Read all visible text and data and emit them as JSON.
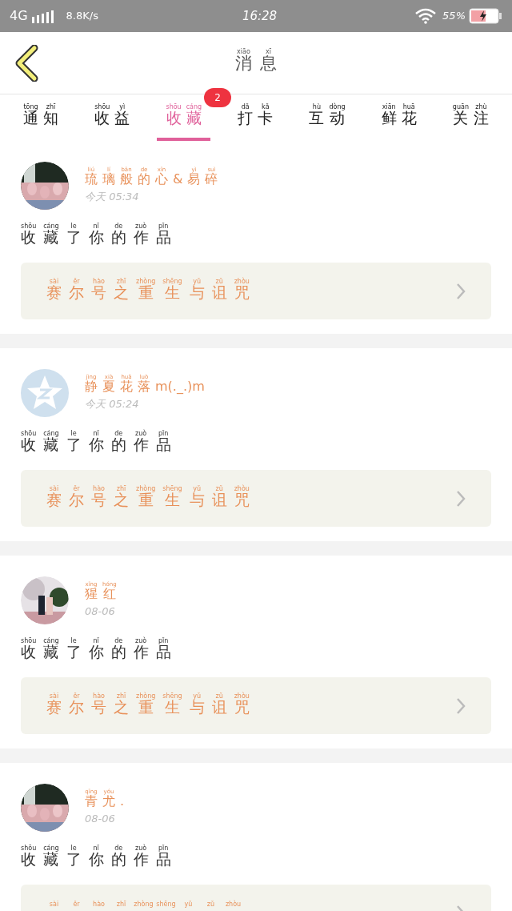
{
  "status_bar": {
    "network": "4G",
    "speed": "8.8K/s",
    "time": "16:28",
    "battery": "55%"
  },
  "header": {
    "title": [
      {
        "pinyin": "xiāo",
        "char": "消"
      },
      {
        "pinyin": "xī",
        "char": "息"
      }
    ]
  },
  "tabs": [
    {
      "label": [
        {
          "pinyin": "tōng",
          "char": "通"
        },
        {
          "pinyin": "zhī",
          "char": "知"
        }
      ],
      "selected": false
    },
    {
      "label": [
        {
          "pinyin": "shōu",
          "char": "收"
        },
        {
          "pinyin": "yì",
          "char": "益"
        }
      ],
      "selected": false
    },
    {
      "label": [
        {
          "pinyin": "shōu",
          "char": "收"
        },
        {
          "pinyin": "cáng",
          "char": "藏"
        }
      ],
      "selected": true,
      "badge": "2"
    },
    {
      "label": [
        {
          "pinyin": "dǎ",
          "char": "打"
        },
        {
          "pinyin": "kǎ",
          "char": "卡"
        }
      ],
      "selected": false
    },
    {
      "label": [
        {
          "pinyin": "hù",
          "char": "互"
        },
        {
          "pinyin": "dòng",
          "char": "动"
        }
      ],
      "selected": false
    },
    {
      "label": [
        {
          "pinyin": "xiān",
          "char": "鲜"
        },
        {
          "pinyin": "huā",
          "char": "花"
        }
      ],
      "selected": false
    },
    {
      "label": [
        {
          "pinyin": "guān",
          "char": "关"
        },
        {
          "pinyin": "zhù",
          "char": "注"
        }
      ],
      "selected": false
    }
  ],
  "items": [
    {
      "avatar": {
        "kind": "picture"
      },
      "name": [
        {
          "pinyin": "liú",
          "char": "琉"
        },
        {
          "pinyin": "lí",
          "char": "璃"
        },
        {
          "pinyin": "bān",
          "char": "般"
        },
        {
          "pinyin": "de",
          "char": "的"
        },
        {
          "pinyin": "xīn",
          "char": "心"
        },
        {
          "char": "&"
        },
        {
          "pinyin": "yì",
          "char": "易"
        },
        {
          "pinyin": "suì",
          "char": "碎"
        }
      ],
      "time": "今天 05:34",
      "action": [
        {
          "pinyin": "shōu",
          "char": "收"
        },
        {
          "pinyin": "cáng",
          "char": "藏"
        },
        {
          "pinyin": "le",
          "char": "了"
        },
        {
          "pinyin": "nǐ",
          "char": "你"
        },
        {
          "pinyin": "de",
          "char": "的"
        },
        {
          "pinyin": "zuò",
          "char": "作"
        },
        {
          "pinyin": "pǐn",
          "char": "品"
        }
      ],
      "work_title": [
        {
          "pinyin": "sài",
          "char": "赛"
        },
        {
          "pinyin": "ěr",
          "char": "尔"
        },
        {
          "pinyin": "hào",
          "char": "号"
        },
        {
          "pinyin": "zhī",
          "char": "之"
        },
        {
          "pinyin": "zhòng",
          "char": "重"
        },
        {
          "pinyin": "shēng",
          "char": "生"
        },
        {
          "pinyin": "yǔ",
          "char": "与"
        },
        {
          "pinyin": "zǔ",
          "char": "诅"
        },
        {
          "pinyin": "zhòu",
          "char": "咒"
        }
      ]
    },
    {
      "avatar": {
        "kind": "default"
      },
      "name": [
        {
          "pinyin": "jìng",
          "char": "静"
        },
        {
          "pinyin": "xià",
          "char": "夏"
        },
        {
          "pinyin": "huā",
          "char": "花"
        },
        {
          "pinyin": "luò",
          "char": "落"
        },
        {
          "char": "m(._.)m"
        }
      ],
      "time": "今天 05:24",
      "action": [
        {
          "pinyin": "shōu",
          "char": "收"
        },
        {
          "pinyin": "cáng",
          "char": "藏"
        },
        {
          "pinyin": "le",
          "char": "了"
        },
        {
          "pinyin": "nǐ",
          "char": "你"
        },
        {
          "pinyin": "de",
          "char": "的"
        },
        {
          "pinyin": "zuò",
          "char": "作"
        },
        {
          "pinyin": "pǐn",
          "char": "品"
        }
      ],
      "work_title": [
        {
          "pinyin": "sài",
          "char": "赛"
        },
        {
          "pinyin": "ěr",
          "char": "尔"
        },
        {
          "pinyin": "hào",
          "char": "号"
        },
        {
          "pinyin": "zhī",
          "char": "之"
        },
        {
          "pinyin": "zhòng",
          "char": "重"
        },
        {
          "pinyin": "shēng",
          "char": "生"
        },
        {
          "pinyin": "yǔ",
          "char": "与"
        },
        {
          "pinyin": "zǔ",
          "char": "诅"
        },
        {
          "pinyin": "zhòu",
          "char": "咒"
        }
      ]
    },
    {
      "avatar": {
        "kind": "picture"
      },
      "name": [
        {
          "pinyin": "xīng",
          "char": "猩"
        },
        {
          "pinyin": "hóng",
          "char": "红"
        }
      ],
      "time": "08-06",
      "action": [
        {
          "pinyin": "shōu",
          "char": "收"
        },
        {
          "pinyin": "cáng",
          "char": "藏"
        },
        {
          "pinyin": "le",
          "char": "了"
        },
        {
          "pinyin": "nǐ",
          "char": "你"
        },
        {
          "pinyin": "de",
          "char": "的"
        },
        {
          "pinyin": "zuò",
          "char": "作"
        },
        {
          "pinyin": "pǐn",
          "char": "品"
        }
      ],
      "work_title": [
        {
          "pinyin": "sài",
          "char": "赛"
        },
        {
          "pinyin": "ěr",
          "char": "尔"
        },
        {
          "pinyin": "hào",
          "char": "号"
        },
        {
          "pinyin": "zhī",
          "char": "之"
        },
        {
          "pinyin": "zhòng",
          "char": "重"
        },
        {
          "pinyin": "shēng",
          "char": "生"
        },
        {
          "pinyin": "yǔ",
          "char": "与"
        },
        {
          "pinyin": "zǔ",
          "char": "诅"
        },
        {
          "pinyin": "zhòu",
          "char": "咒"
        }
      ]
    },
    {
      "avatar": {
        "kind": "picture"
      },
      "name": [
        {
          "pinyin": "qīng",
          "char": "青"
        },
        {
          "pinyin": "yóu",
          "char": "尤"
        },
        {
          "char": "."
        }
      ],
      "time": "08-06",
      "action": [
        {
          "pinyin": "shōu",
          "char": "收"
        },
        {
          "pinyin": "cáng",
          "char": "藏"
        },
        {
          "pinyin": "le",
          "char": "了"
        },
        {
          "pinyin": "nǐ",
          "char": "你"
        },
        {
          "pinyin": "de",
          "char": "的"
        },
        {
          "pinyin": "zuò",
          "char": "作"
        },
        {
          "pinyin": "pǐn",
          "char": "品"
        }
      ],
      "work_title": [
        {
          "pinyin": "sài"
        },
        {
          "pinyin": "ěr"
        },
        {
          "pinyin": "hào"
        },
        {
          "pinyin": "zhī"
        },
        {
          "pinyin": "zhòng"
        },
        {
          "pinyin": "shēng"
        },
        {
          "pinyin": "yǔ"
        },
        {
          "pinyin": "zǔ"
        },
        {
          "pinyin": "zhòu"
        }
      ]
    }
  ]
}
